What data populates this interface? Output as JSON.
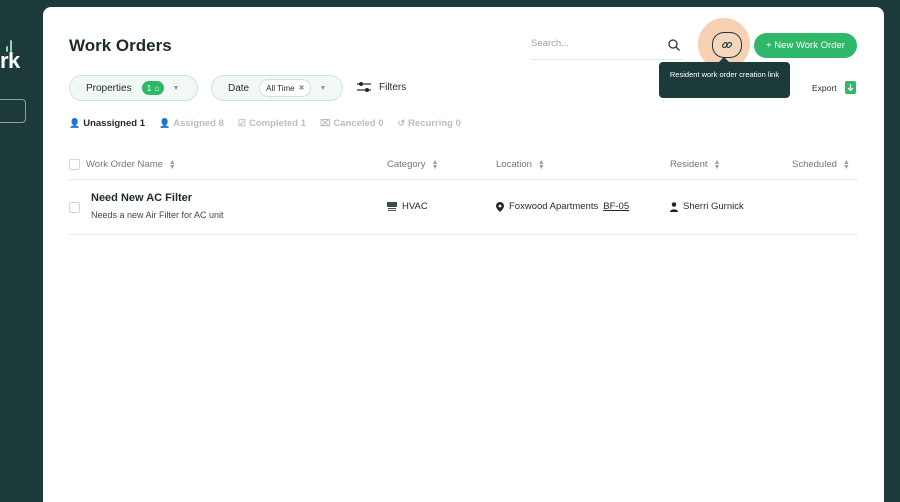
{
  "sidebar": {
    "logo_text": "rk"
  },
  "header": {
    "title": "Work Orders",
    "search_placeholder": "Search...",
    "tooltip_text": "Resident work order creation link",
    "new_work_order_label": "+ New Work Order",
    "export_label": "Export"
  },
  "filters": {
    "properties_label": "Properties",
    "properties_count": "1",
    "date_label": "Date",
    "date_value": "All Time",
    "filters_label": "Filters"
  },
  "tabs": [
    {
      "label": "Unassigned 1",
      "icon": "person-x-icon"
    },
    {
      "label": "Assigned 8",
      "icon": "person-icon"
    },
    {
      "label": "Completed 1",
      "icon": "check-square-icon"
    },
    {
      "label": "Canceled 0",
      "icon": "x-square-icon"
    },
    {
      "label": "Recurring 0",
      "icon": "recurring-icon"
    }
  ],
  "table": {
    "columns": [
      "Work Order Name",
      "Category",
      "Location",
      "Resident",
      "Scheduled"
    ],
    "rows": [
      {
        "title": "Need New AC Filter",
        "description": "Needs a new Air Filter for AC unit",
        "category": "HVAC",
        "location_name": "Foxwood Apartments",
        "location_unit": "BF-05",
        "resident": "Sherri Gurnick",
        "scheduled": ""
      }
    ]
  },
  "colors": {
    "brand_dark": "#1c3a3a",
    "accent_green": "#2fb86a",
    "highlight": "#f7c9a4"
  }
}
